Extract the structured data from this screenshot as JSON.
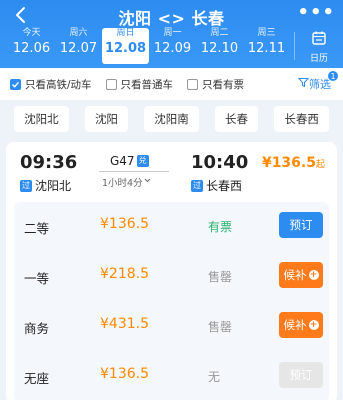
{
  "header": {
    "title": "沈阳 <> 长春",
    "more_glyph": "•••",
    "calendar_label": "日历",
    "dates": [
      {
        "weekday": "今天",
        "date": "12.06"
      },
      {
        "weekday": "周六",
        "date": "12.07"
      },
      {
        "weekday": "周日",
        "date": "12.08",
        "selected": true
      },
      {
        "weekday": "周一",
        "date": "12.09"
      },
      {
        "weekday": "周二",
        "date": "12.10"
      },
      {
        "weekday": "周三",
        "date": "12.11"
      }
    ],
    "colors": {
      "primary": "#2d8cf0",
      "orange": "#ff8a00",
      "green": "#29b36b"
    }
  },
  "filters": {
    "options": [
      {
        "label": "只看高铁/动车",
        "checked": true
      },
      {
        "label": "只看普通车",
        "checked": false
      },
      {
        "label": "只看有票",
        "checked": false
      }
    ],
    "filter_label": "筛选",
    "filter_badge": "1"
  },
  "stations": [
    "沈阳北",
    "沈阳",
    "沈阳南",
    "长春",
    "长春西"
  ],
  "train": {
    "dep_time": "09:36",
    "arr_time": "10:40",
    "number": "G47",
    "number_tag": "兑",
    "duration": "1小时4分",
    "dep_station": "沈阳北",
    "arr_station": "长春西",
    "dep_tag": "过",
    "arr_tag": "过",
    "min_price": "¥136.5",
    "min_price_suffix": "起",
    "seats": [
      {
        "name": "二等",
        "price": "¥136.5",
        "status": "有票",
        "action": "预订",
        "type": "book"
      },
      {
        "name": "一等",
        "price": "¥218.5",
        "status": "售罄",
        "action": "候补",
        "type": "wait"
      },
      {
        "name": "商务",
        "price": "¥431.5",
        "status": "售罄",
        "action": "候补",
        "type": "wait"
      },
      {
        "name": "无座",
        "price": "¥136.5",
        "status": "无",
        "action": "预订",
        "type": "off"
      }
    ]
  }
}
